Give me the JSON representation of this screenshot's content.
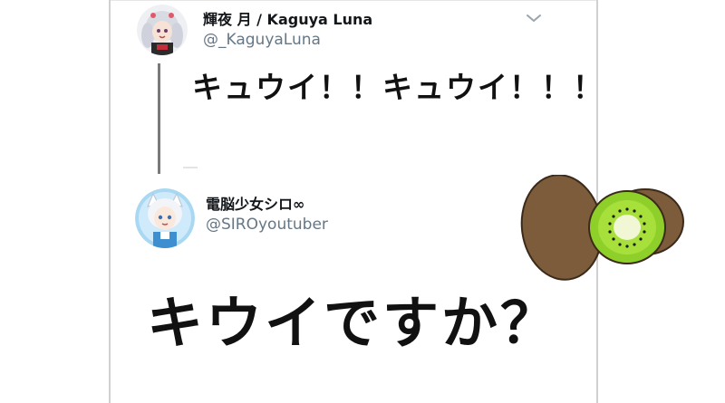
{
  "tweet1": {
    "display_name": "輝夜 月 / Kaguya Luna",
    "handle": "@_KaguyaLuna",
    "text": "キュウイ！！キュウイ！！！"
  },
  "tweet2": {
    "display_name": "電脳少女シロ∞",
    "handle": "@SIROyoutuber",
    "text": "キウイですか？"
  },
  "icons": {
    "menu": "chevron-down-icon",
    "illustration": "kiwi-fruit-illustration"
  },
  "colors": {
    "name_text": "#14171a",
    "handle_text": "#657786",
    "thread_line": "#7a7a7a",
    "kiwi_skin": "#7d5c3c",
    "kiwi_flesh": "#8fcf2a"
  }
}
